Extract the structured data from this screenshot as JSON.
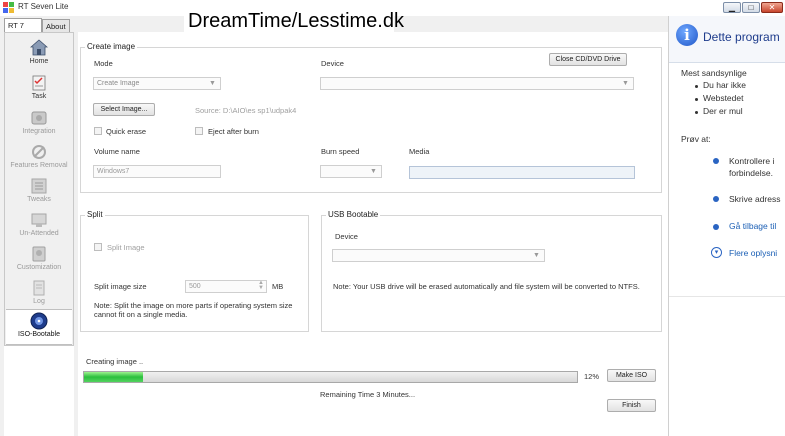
{
  "window": {
    "title": "RT Seven Lite",
    "overlay_title": "DreamTime/Lesstime.dk",
    "minimize": "▁",
    "maximize": "□",
    "close": "✕"
  },
  "tabs": [
    {
      "label": "RT 7 Lite"
    },
    {
      "label": "About"
    }
  ],
  "sidebar": {
    "items": [
      {
        "label": "Home",
        "icon": "home-icon"
      },
      {
        "label": "Task",
        "icon": "task-icon"
      },
      {
        "label": "Integration",
        "icon": "integration-icon"
      },
      {
        "label": "Features Removal",
        "icon": "features-removal-icon"
      },
      {
        "label": "Tweaks",
        "icon": "tweaks-icon"
      },
      {
        "label": "Un-Attended",
        "icon": "unattended-icon"
      },
      {
        "label": "Customization",
        "icon": "customization-icon"
      },
      {
        "label": "Log",
        "icon": "log-icon"
      },
      {
        "label": "ISO-Bootable",
        "icon": "iso-bootable-icon"
      }
    ]
  },
  "create_image": {
    "group_label": "Create image",
    "mode_label": "Mode",
    "mode_value": "Create Image",
    "device_label": "Device",
    "close_drive_button": "Close CD/DVD Drive",
    "select_image_button": "Select Image...",
    "source_text": "Source: D:\\AIO\\es sp1\\udpak4",
    "quick_erase_label": "Quick erase",
    "eject_label": "Eject after burn",
    "volume_label": "Volume name",
    "volume_value": "Windows7",
    "burn_speed_label": "Burn speed",
    "media_label": "Media"
  },
  "split": {
    "group_label": "Split",
    "split_image_label": "Split Image",
    "size_label": "Split image size",
    "size_value": "500",
    "size_unit": "MB",
    "note_line1": "Note: Split the image on more parts if operating system size",
    "note_line2": "cannot fit on a single media."
  },
  "usb": {
    "group_label": "USB Bootable",
    "device_label": "Device",
    "note": "Note: Your USB drive will be erased automatically and file system will be converted to NTFS."
  },
  "progress": {
    "status": "Creating image ..",
    "percent_value": 12,
    "percent_label": "12%",
    "make_iso_button": "Make ISO",
    "remaining": "Remaining Time 3 Minutes...",
    "finish_button": "Finish"
  },
  "right_panel": {
    "title": "Dette program",
    "cause_heading": "Mest sandsynlige",
    "bullets": [
      "Du har ikke",
      "Webstedet",
      "Der er mul"
    ],
    "try_heading": "Prøv at:",
    "actions": [
      {
        "line1": "Kontrollere i",
        "line2": "forbindelse."
      },
      {
        "line1": "Skrive adress",
        "line2": ""
      },
      {
        "line1": "Gå tilbage til",
        "line2": ""
      }
    ],
    "more_info": "Flere oplysni"
  },
  "colors": {
    "progress_fill": "#2bbf3d",
    "accent_blue": "#2a64c2",
    "right_title": "#1e3c8c"
  }
}
